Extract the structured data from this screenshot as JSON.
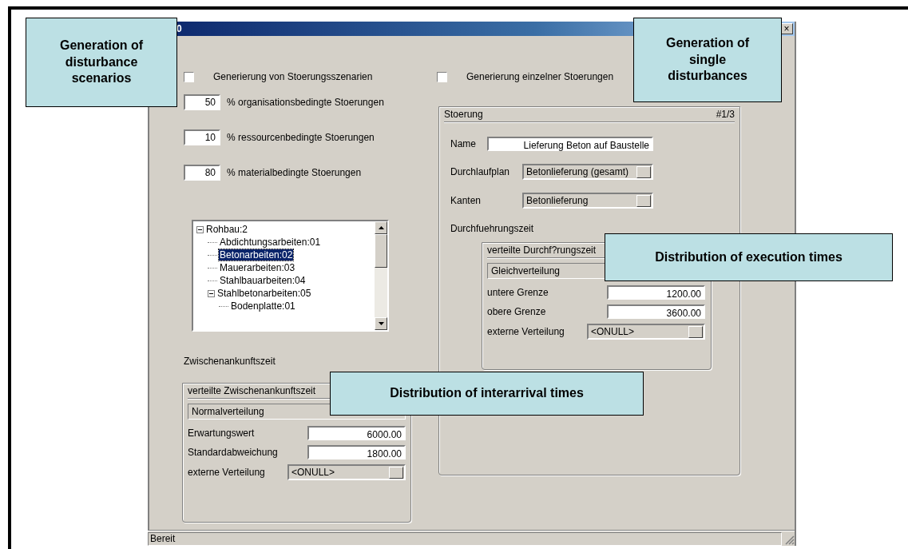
{
  "window": {
    "title": "0",
    "close": "×"
  },
  "scenarios": {
    "label": "Generierung von Stoerungsszenarien",
    "checked": false,
    "shares": [
      {
        "value": "50",
        "label": "% organisationsbedingte Stoerungen"
      },
      {
        "value": "10",
        "label": "% ressourcenbedingte Stoerungen"
      },
      {
        "value": "80",
        "label": "% materialbedingte Stoerungen"
      }
    ]
  },
  "tree": [
    {
      "label": "Rohbau:2",
      "selected": false,
      "expanded": true,
      "children": [
        {
          "label": "Abdichtungsarbeiten:01",
          "selected": false
        },
        {
          "label": "Betonarbeiten:02",
          "selected": true
        },
        {
          "label": "Mauerarbeiten:03",
          "selected": false
        },
        {
          "label": "Stahlbauarbeiten:04",
          "selected": false
        },
        {
          "label": "Stahlbetonarbeiten:05",
          "selected": false,
          "expanded": true,
          "children": [
            {
              "label": "Bodenplatte:01",
              "selected": false
            }
          ]
        }
      ]
    }
  ],
  "interarrival": {
    "heading": "Zwischenankunftszeit",
    "title": "verteilte Zwischenankunftszeit",
    "distribution": "Normalverteilung",
    "fields": [
      {
        "label": "Erwartungswert",
        "value": "6000.00"
      },
      {
        "label": "Standardabweichung",
        "value": "1800.00"
      }
    ],
    "external": {
      "label": "externe Verteilung",
      "value": "<ONULL>"
    }
  },
  "single": {
    "label": "Generierung einzelner Stoerungen",
    "checked": false,
    "group": {
      "title": "Stoerung",
      "counter": "#1/3",
      "fields": [
        {
          "kind": "text",
          "label": "Name",
          "value": "Lieferung Beton auf Baustelle"
        },
        {
          "kind": "combo",
          "label": "Durchlaufplan",
          "value": "Betonlieferung (gesamt)"
        },
        {
          "kind": "combo",
          "label": "Kanten",
          "value": "Betonlieferung"
        }
      ],
      "heading": "Durchfuehrungszeit",
      "execution": {
        "title": "verteilte Durchf?rungszeit",
        "distribution": "Gleichverteilung",
        "fields": [
          {
            "label": "untere Grenze",
            "value": "1200.00"
          },
          {
            "label": "obere Grenze",
            "value": "3600.00"
          }
        ],
        "external": {
          "label": "externe Verteilung",
          "value": "<ONULL>"
        }
      }
    }
  },
  "status_bar": "Bereit",
  "callouts": [
    "Generation of disturbance scenarios",
    "Generation of single disturbances",
    "Distribution of execution times",
    "Distribution of interarrival times"
  ]
}
